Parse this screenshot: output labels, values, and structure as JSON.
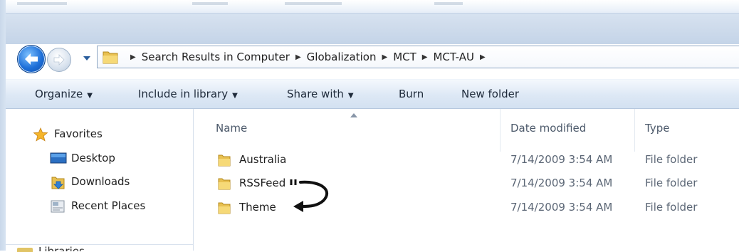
{
  "address_bar": {
    "breadcrumbs": [
      "Search Results in Computer",
      "Globalization",
      "MCT",
      "MCT-AU"
    ]
  },
  "toolbar": {
    "organize": "Organize",
    "include_in_library": "Include in library",
    "share_with": "Share with",
    "burn": "Burn",
    "new_folder": "New folder"
  },
  "nav_pane": {
    "favorites": "Favorites",
    "items": [
      {
        "label": "Desktop",
        "icon": "desktop-icon"
      },
      {
        "label": "Downloads",
        "icon": "downloads-folder-icon"
      },
      {
        "label": "Recent Places",
        "icon": "recent-places-icon"
      }
    ],
    "libraries_partial": "Libraries"
  },
  "file_list": {
    "columns": [
      "Name",
      "Date modified",
      "Type"
    ],
    "rows": [
      {
        "name": "Australia",
        "date_modified": "7/14/2009 3:54 AM",
        "type": "File folder"
      },
      {
        "name": "RSSFeed",
        "date_modified": "7/14/2009 3:54 AM",
        "type": "File folder"
      },
      {
        "name": "Theme",
        "date_modified": "7/14/2009 3:54 AM",
        "type": "File folder"
      }
    ]
  },
  "colors": {
    "toolbar_gradient_top": "#f4f8fd",
    "toolbar_gradient_bottom": "#d3e1f1",
    "header_text": "#4d5a6b",
    "folder_yellow": "#e8c050"
  }
}
